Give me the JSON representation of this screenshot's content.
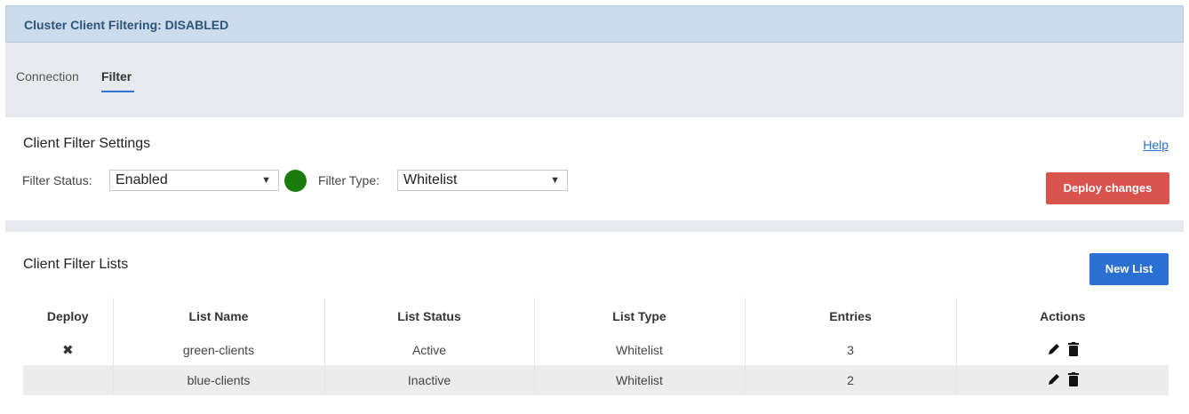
{
  "banner": {
    "text": "Cluster Client Filtering: DISABLED"
  },
  "tabs": [
    {
      "label": "Connection",
      "active": false
    },
    {
      "label": "Filter",
      "active": true
    }
  ],
  "settings": {
    "title": "Client Filter Settings",
    "help_label": "Help",
    "filter_status_label": "Filter Status:",
    "filter_status_value": "Enabled",
    "status_color": "#1a7a0a",
    "filter_type_label": "Filter Type:",
    "filter_type_value": "Whitelist",
    "deploy_label": "Deploy changes"
  },
  "lists": {
    "title": "Client Filter Lists",
    "new_list_label": "New List",
    "columns": [
      "Deploy",
      "List Name",
      "List Status",
      "List Type",
      "Entries",
      "Actions"
    ],
    "rows": [
      {
        "deploy_icon": "x-icon",
        "name": "green-clients",
        "status": "Active",
        "type": "Whitelist",
        "entries": "3"
      },
      {
        "deploy_icon": "",
        "name": "blue-clients",
        "status": "Inactive",
        "type": "Whitelist",
        "entries": "2"
      }
    ]
  },
  "icons": {
    "edit": "pencil-icon",
    "delete": "trash-icon"
  },
  "colors": {
    "accent": "#2a6fd1",
    "danger": "#d9534f",
    "banner_bg": "#cddcec"
  }
}
